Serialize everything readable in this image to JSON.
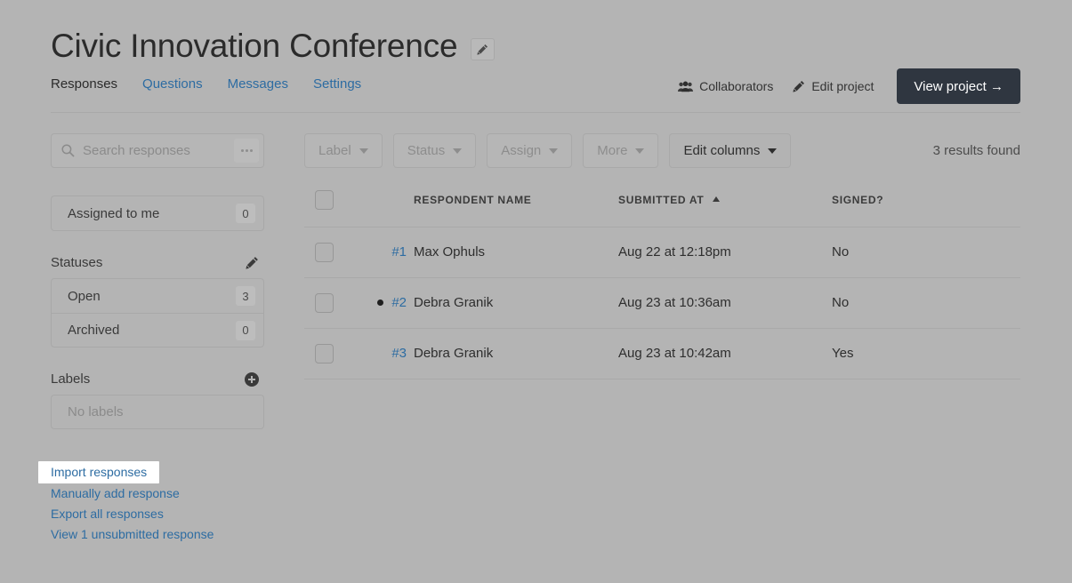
{
  "header": {
    "title": "Civic Innovation Conference",
    "edit_title_icon": "pencil-icon",
    "tabs": [
      {
        "label": "Responses",
        "active": true
      },
      {
        "label": "Questions",
        "active": false
      },
      {
        "label": "Messages",
        "active": false
      },
      {
        "label": "Settings",
        "active": false
      }
    ],
    "actions": {
      "collaborators_label": "Collaborators",
      "collaborators_icon": "users-group-icon",
      "edit_project_label": "Edit project",
      "edit_project_icon": "pencil-icon",
      "view_project_label": "View project →"
    }
  },
  "sidebar": {
    "search": {
      "placeholder": "Search responses",
      "icon": "search-icon",
      "more_icon": "ellipsis-icon"
    },
    "assigned": {
      "label": "Assigned to me",
      "count": "0"
    },
    "statuses": {
      "title": "Statuses",
      "edit_icon": "pencil-icon",
      "items": [
        {
          "label": "Open",
          "count": "3"
        },
        {
          "label": "Archived",
          "count": "0"
        }
      ]
    },
    "labels": {
      "title": "Labels",
      "add_icon": "plus-circle-icon",
      "empty_text": "No labels"
    },
    "links": [
      {
        "label": "Import responses",
        "highlighted": true
      },
      {
        "label": "Manually add response",
        "highlighted": false
      },
      {
        "label": "Export all responses",
        "highlighted": false
      },
      {
        "label": "View 1 unsubmitted response",
        "highlighted": false
      }
    ]
  },
  "main": {
    "toolbar": [
      {
        "label": "Label",
        "enabled": false
      },
      {
        "label": "Status",
        "enabled": false
      },
      {
        "label": "Assign",
        "enabled": false
      },
      {
        "label": "More",
        "enabled": false
      },
      {
        "label": "Edit columns",
        "enabled": true
      }
    ],
    "results_count": "3 results found",
    "table": {
      "columns": [
        "RESPONDENT NAME",
        "SUBMITTED AT",
        "SIGNED?"
      ],
      "sorted_column": "SUBMITTED AT",
      "sort_direction": "asc",
      "rows": [
        {
          "num": "#1",
          "unread": false,
          "name": "Max Ophuls",
          "submitted_at": "Aug 22 at 12:18pm",
          "signed": "No"
        },
        {
          "num": "#2",
          "unread": true,
          "name": "Debra Granik",
          "submitted_at": "Aug 23 at 10:36am",
          "signed": "No"
        },
        {
          "num": "#3",
          "unread": false,
          "name": "Debra Granik",
          "submitted_at": "Aug 23 at 10:42am",
          "signed": "Yes"
        }
      ]
    }
  },
  "colors": {
    "page_background": "#b4b4b4",
    "link": "#2d6ca2",
    "primary_button": "#2f3640",
    "text": "#2e2e2e",
    "muted_text": "#8b8b8b",
    "highlight": "#ffffff"
  }
}
